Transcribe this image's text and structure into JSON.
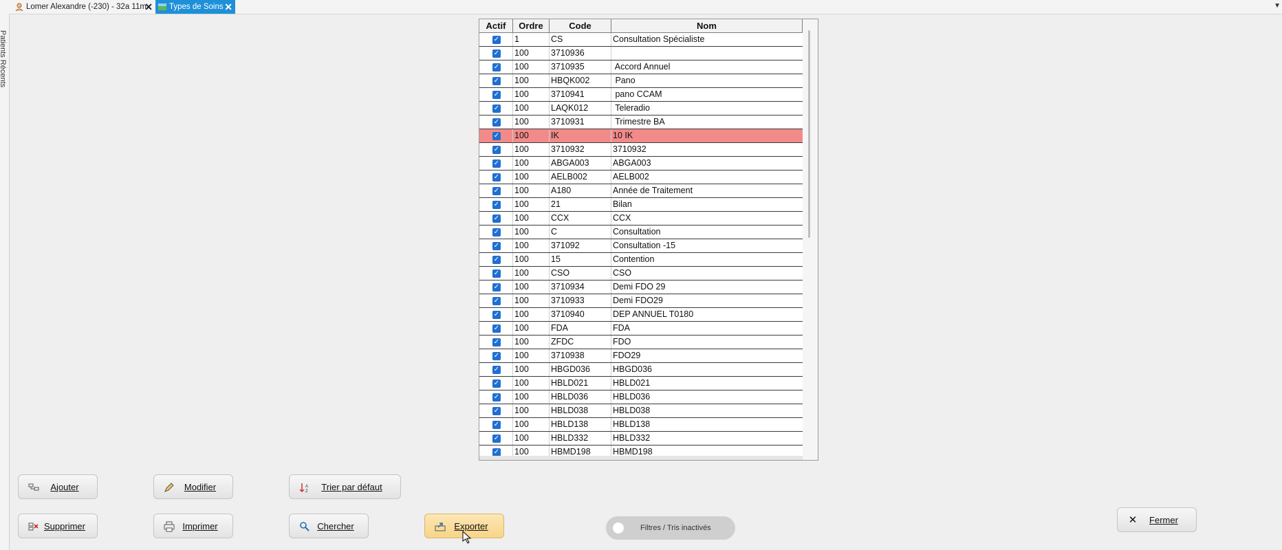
{
  "tabs": [
    {
      "label": "Lomer Alexandre (-230) - 32a 11m",
      "icon": "patient-icon",
      "active": false
    },
    {
      "label": "Types de Soins",
      "icon": "map-icon",
      "active": true
    }
  ],
  "side_panel": {
    "label": "Patients Récents"
  },
  "table": {
    "columns": [
      "Actif",
      "Ordre",
      "Code",
      "Nom"
    ],
    "rows": [
      {
        "actif": true,
        "ordre": "1",
        "code": "CS",
        "nom": "Consultation Spécialiste"
      },
      {
        "actif": true,
        "ordre": "100",
        "code": "3710936",
        "nom": ""
      },
      {
        "actif": true,
        "ordre": "100",
        "code": "3710935",
        "nom": " Accord Annuel"
      },
      {
        "actif": true,
        "ordre": "100",
        "code": "HBQK002",
        "nom": " Pano"
      },
      {
        "actif": true,
        "ordre": "100",
        "code": "3710941",
        "nom": " pano CCAM"
      },
      {
        "actif": true,
        "ordre": "100",
        "code": "LAQK012",
        "nom": " Teleradio"
      },
      {
        "actif": true,
        "ordre": "100",
        "code": "3710931",
        "nom": " Trimestre BA"
      },
      {
        "actif": true,
        "ordre": "100",
        "code": "IK",
        "nom": "10 IK",
        "highlight": true
      },
      {
        "actif": true,
        "ordre": "100",
        "code": "3710932",
        "nom": "3710932"
      },
      {
        "actif": true,
        "ordre": "100",
        "code": "ABGA003",
        "nom": "ABGA003"
      },
      {
        "actif": true,
        "ordre": "100",
        "code": "AELB002",
        "nom": "AELB002"
      },
      {
        "actif": true,
        "ordre": "100",
        "code": "A180",
        "nom": "Année de Traitement"
      },
      {
        "actif": true,
        "ordre": "100",
        "code": "21",
        "nom": "Bilan"
      },
      {
        "actif": true,
        "ordre": "100",
        "code": "CCX",
        "nom": "CCX"
      },
      {
        "actif": true,
        "ordre": "100",
        "code": "C",
        "nom": "Consultation"
      },
      {
        "actif": true,
        "ordre": "100",
        "code": "371092",
        "nom": "Consultation -15"
      },
      {
        "actif": true,
        "ordre": "100",
        "code": "15",
        "nom": "Contention"
      },
      {
        "actif": true,
        "ordre": "100",
        "code": "CSO",
        "nom": "CSO"
      },
      {
        "actif": true,
        "ordre": "100",
        "code": "3710934",
        "nom": "Demi FDO 29"
      },
      {
        "actif": true,
        "ordre": "100",
        "code": "3710933",
        "nom": "Demi FDO29"
      },
      {
        "actif": true,
        "ordre": "100",
        "code": "3710940",
        "nom": "DEP ANNUEL T0180"
      },
      {
        "actif": true,
        "ordre": "100",
        "code": "FDA",
        "nom": "FDA"
      },
      {
        "actif": true,
        "ordre": "100",
        "code": "ZFDC",
        "nom": "FDO"
      },
      {
        "actif": true,
        "ordre": "100",
        "code": "3710938",
        "nom": "FDO29"
      },
      {
        "actif": true,
        "ordre": "100",
        "code": "HBGD036",
        "nom": "HBGD036"
      },
      {
        "actif": true,
        "ordre": "100",
        "code": "HBLD021",
        "nom": "HBLD021"
      },
      {
        "actif": true,
        "ordre": "100",
        "code": "HBLD036",
        "nom": "HBLD036"
      },
      {
        "actif": true,
        "ordre": "100",
        "code": "HBLD038",
        "nom": "HBLD038"
      },
      {
        "actif": true,
        "ordre": "100",
        "code": "HBLD138",
        "nom": "HBLD138"
      },
      {
        "actif": true,
        "ordre": "100",
        "code": "HBLD332",
        "nom": "HBLD332"
      },
      {
        "actif": true,
        "ordre": "100",
        "code": "HBMD198",
        "nom": "HBMD198"
      }
    ]
  },
  "buttons": {
    "ajouter": "Ajouter",
    "modifier": "Modifier",
    "trier": "Trier par défaut",
    "supprimer": "Supprimer",
    "imprimer": "Imprimer",
    "chercher": "Chercher",
    "exporter": "Exporter",
    "fermer": "Fermer"
  },
  "filter_toggle": {
    "label": "Filtres / Tris inactivés",
    "on": false
  },
  "colors": {
    "accent": "#1e90d8",
    "highlight_row": "#f28a8a",
    "checkbox": "#1f6fd1",
    "export_button": "#f7d489"
  }
}
